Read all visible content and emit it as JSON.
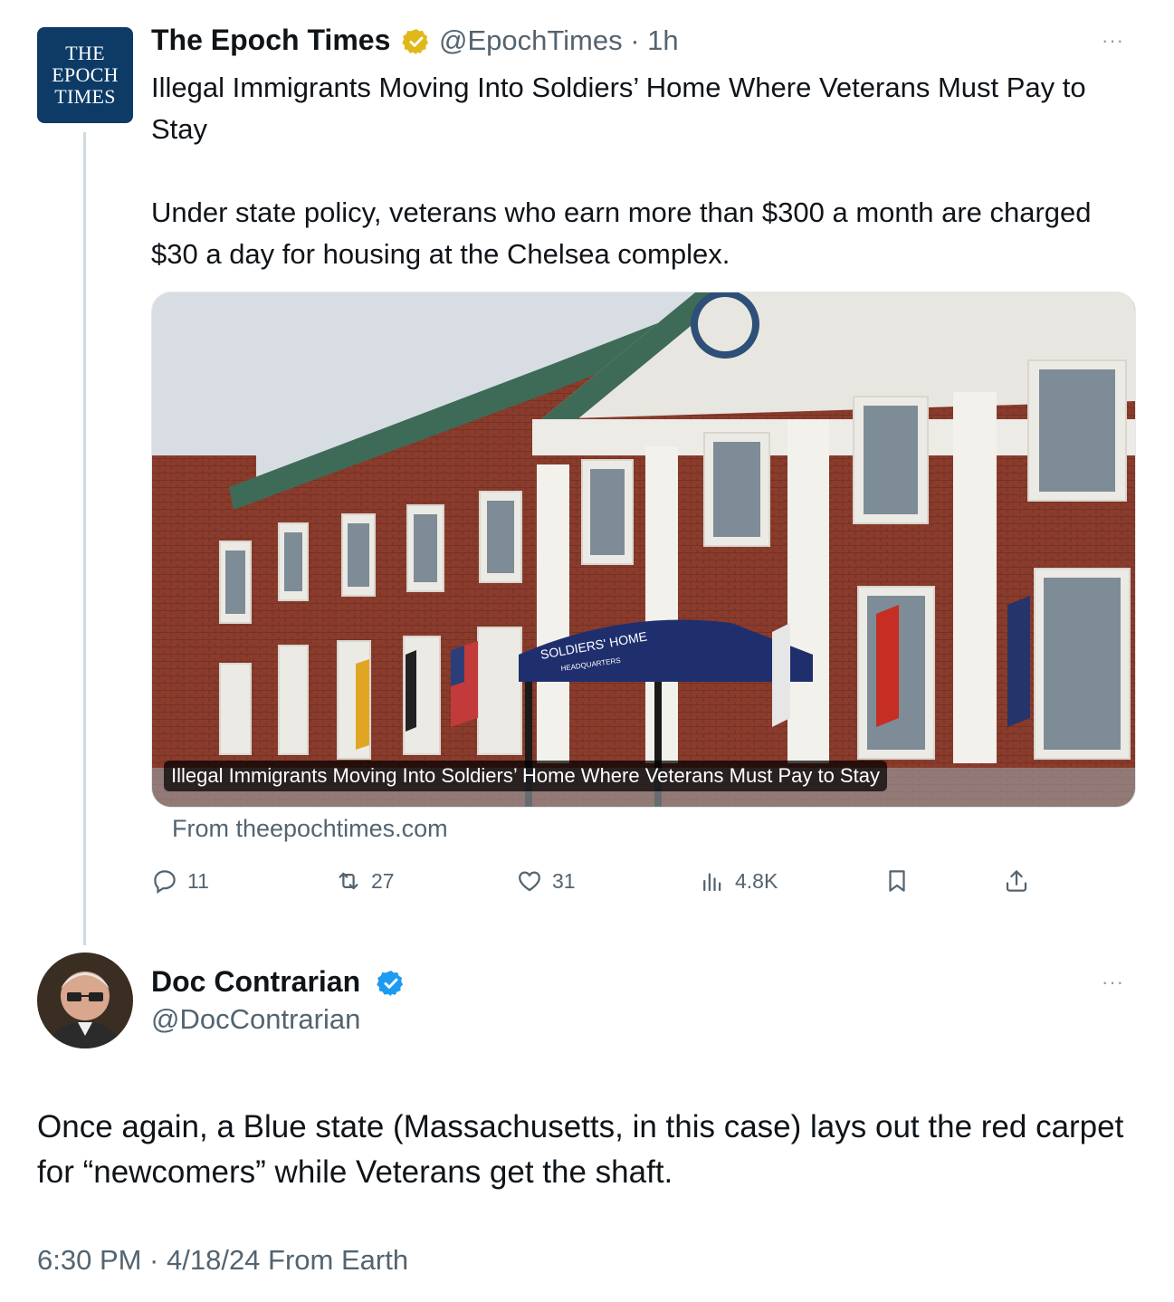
{
  "quoted_tweet": {
    "avatar_lines": [
      "THE",
      "EPOCH",
      "TIMES"
    ],
    "display_name": "The Epoch Times",
    "handle_time": "@EpochTimes · 1h",
    "more": "···",
    "text": "Illegal Immigrants Moving Into Soldiers’ Home Where Veterans Must Pay to Stay\n\nUnder state policy, veterans who earn more than $300 a month are charged $30 a day for housing at the Chelsea complex.",
    "card": {
      "caption": "Illegal Immigrants Moving Into Soldiers’ Home Where Veterans Must Pay to Stay",
      "awning_text": "SOLDIERS' HOME",
      "awning_subtext": "HEADQUARTERS",
      "source": "From theepochtimes.com"
    },
    "actions": {
      "replies": "11",
      "retweets": "27",
      "likes": "31",
      "views": "4.8K"
    }
  },
  "main_tweet": {
    "display_name": "Doc Contrarian",
    "handle": "@DocContrarian",
    "more": "···",
    "text": "Once again, a Blue state (Massachusetts, in this case) lays out the red carpet for “newcomers” while Veterans get the shaft.",
    "meta": "6:30 PM · 4/18/24 From Earth"
  },
  "colors": {
    "verified_gold": "#e2b719",
    "verified_blue": "#1d9bf0",
    "secondary_text": "#536471",
    "thread_line": "#cfd9de",
    "epoch_brand": "#0d3b66"
  }
}
